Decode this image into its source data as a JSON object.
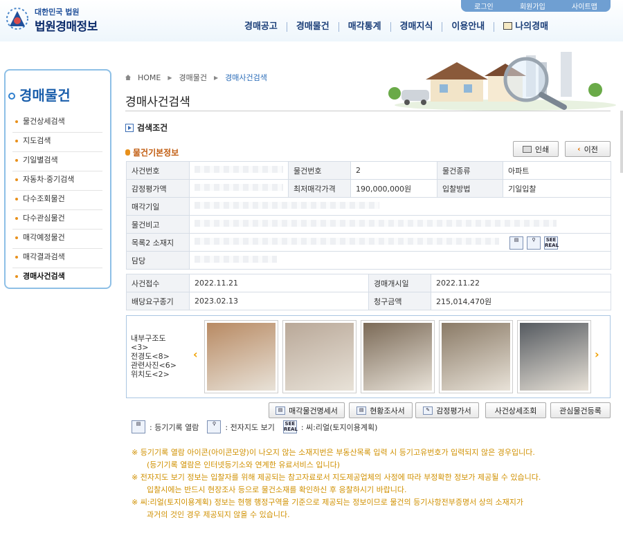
{
  "header": {
    "org_small": "대한민국 법원",
    "org_name": "법원경매정보",
    "util": [
      "로그인",
      "회원가입",
      "사이트맵"
    ],
    "gnb": [
      "경매공고",
      "경매물건",
      "매각통계",
      "경매지식",
      "이용안내",
      "나의경매"
    ]
  },
  "sidebar": {
    "title": "경매물건",
    "items": [
      "물건상세검색",
      "지도검색",
      "기일별검색",
      "자동차·중기검색",
      "다수조회물건",
      "다수관심물건",
      "매각예정물건",
      "매각결과검색",
      "경매사건검색"
    ],
    "active_index": 8
  },
  "breadcrumb": [
    "HOME",
    "경매물건",
    "경매사건검색"
  ],
  "page_title": "경매사건검색",
  "search_cond": "검색조건",
  "section_title": "물건기본정보",
  "buttons": {
    "print": "인쇄",
    "prev": "이전"
  },
  "basic_info": {
    "labels": {
      "case_no": "사건번호",
      "item_no": "물건번호",
      "item_type": "물건종류",
      "appraisal": "감정평가액",
      "min_price": "최저매각가격",
      "bid_method": "입찰방법",
      "sale_date": "매각기일",
      "remarks": "물건비고",
      "location": "목록2 소재지",
      "manager": "담당"
    },
    "values": {
      "item_no": "2",
      "item_type": "아파트",
      "min_price": "190,000,000원",
      "bid_method": "기일입찰"
    }
  },
  "case_info": {
    "rows": [
      {
        "l1": "사건접수",
        "v1": "2022.11.21",
        "l2": "경매개시일",
        "v2": "2022.11.22"
      },
      {
        "l1": "배당요구종기",
        "v1": "2023.02.13",
        "l2": "청구금액",
        "v2": "215,014,470원"
      }
    ]
  },
  "photos": {
    "labels": [
      "내부구조도<3>",
      "전경도<8>",
      "관련사진<6>",
      "위치도<2>"
    ],
    "thumb_colors": [
      "#b88a63",
      "#b9a898",
      "#7b6a57",
      "#8a7a66",
      "#555a60"
    ]
  },
  "actions": [
    "매각물건명세서",
    "현황조사서",
    "감정평가서",
    "사건상세조회",
    "관심물건등록"
  ],
  "legend": [
    {
      "icon": "registry-icon",
      "text": ": 등기기록 열람"
    },
    {
      "icon": "map-icon",
      "text": ": 전자지도 보기"
    },
    {
      "icon": "seereal-icon",
      "text": ": 씨:리얼(토지이용계획)"
    }
  ],
  "notes": [
    "※ 등기기록 열람 아이콘(아이콘모양)이 나오지 않는 소재지번은 부동산목록 입력 시 등기고유번호가 입력되지 않은 경우입니다.",
    "(등기기록 열람은 인터넷등기소와 연계한 유료서비스 입니다)",
    "※ 전자지도 보기 정보는 입찰자를 위해 제공되는 참고자료로서 지도제공업체의 사정에 따라 부정확한 정보가 제공될 수 있습니다.",
    "입찰시에는 반드시 현장조사 등으로 물건소재를 확인하신 후 응찰하시기 바랍니다.",
    "※ 씨:리얼(토지이용계획) 정보는 현행 행정구역을 기준으로 제공되는 정보이므로 물건의 등기사항전부증명서 상의 소재지가",
    "과거의 것인 경우 제공되지 않을 수 있습니다."
  ],
  "colors": {
    "brand": "#1b3e78",
    "accent": "#e8901b",
    "note": "#d09000"
  }
}
